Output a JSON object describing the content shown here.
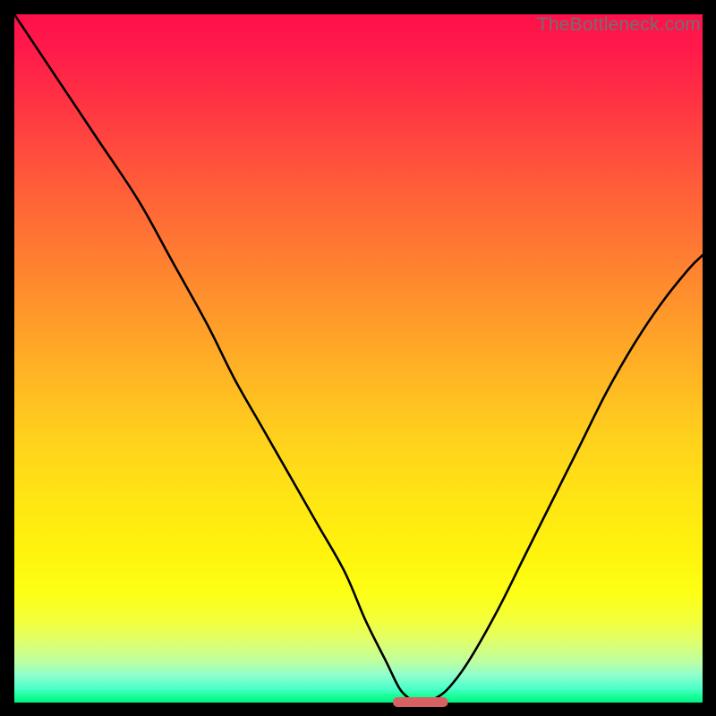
{
  "watermark": "TheBottleneck.com",
  "chart_data": {
    "type": "line",
    "title": "",
    "xlabel": "",
    "ylabel": "",
    "xlim": [
      0,
      100
    ],
    "ylim": [
      0,
      100
    ],
    "gradient_colors": {
      "top": "#ff1049",
      "mid_upper": "#ff8330",
      "mid": "#ffe414",
      "mid_lower": "#beffa0",
      "bottom": "#00f37f"
    },
    "marker": {
      "x_range": [
        55,
        63
      ],
      "y": 0,
      "color": "#d76060"
    },
    "series": [
      {
        "name": "left-branch",
        "x": [
          0,
          6,
          12,
          18,
          23,
          28,
          32,
          36,
          40,
          44,
          48,
          51,
          54,
          56,
          57.5
        ],
        "y": [
          100,
          91,
          82,
          73,
          64,
          55,
          47,
          40,
          33,
          26,
          19,
          12,
          6,
          2,
          0.5
        ]
      },
      {
        "name": "right-branch",
        "x": [
          61,
          63,
          66,
          70,
          74,
          78,
          82,
          86,
          90,
          94,
          98,
          100
        ],
        "y": [
          0.5,
          2,
          6,
          13,
          21,
          29,
          37,
          45,
          52,
          58,
          63,
          65
        ]
      }
    ]
  }
}
